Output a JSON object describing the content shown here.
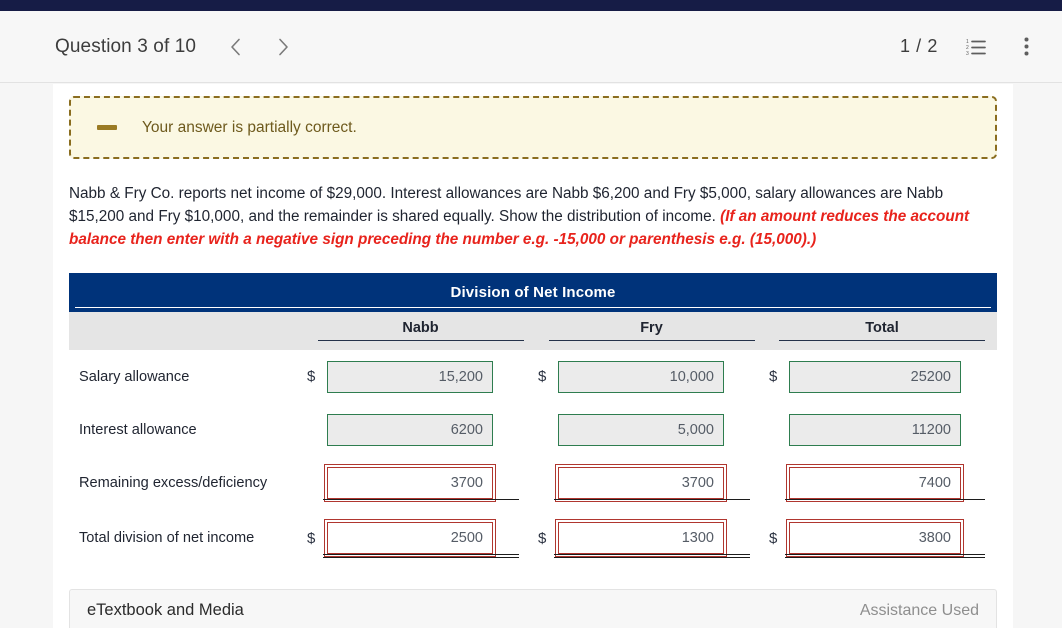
{
  "header": {
    "question_title": "Question 3 of 10",
    "prev_icon": "chevron-left-icon",
    "next_icon": "chevron-right-icon",
    "page_count": "1 / 2",
    "list_icon": "numbered-list-icon",
    "menu_icon": "more-vertical-icon"
  },
  "alert": {
    "icon": "minus-icon",
    "message": "Your answer is partially correct."
  },
  "question": {
    "body": "Nabb & Fry Co. reports net income of $29,000. Interest allowances are Nabb $6,200 and Fry $5,000, salary allowances are Nabb $15,200 and Fry $10,000, and the remainder is shared equally. Show the distribution of income. ",
    "warning": "(If an amount reduces the account balance then enter with a negative sign preceding the number e.g. -15,000 or parenthesis e.g. (15,000).)"
  },
  "table": {
    "title": "Division of Net Income",
    "columns": [
      "",
      "Nabb",
      "Fry",
      "Total"
    ],
    "rows": [
      {
        "label": "Salary allowance",
        "show_dollar": true,
        "underline": "none",
        "cells": [
          {
            "value": "15,200",
            "state": "correct"
          },
          {
            "value": "10,000",
            "state": "correct"
          },
          {
            "value": "25200",
            "state": "correct"
          }
        ]
      },
      {
        "label": "Interest allowance",
        "show_dollar": false,
        "underline": "none",
        "cells": [
          {
            "value": "6200",
            "state": "correct"
          },
          {
            "value": "5,000",
            "state": "correct"
          },
          {
            "value": "11200",
            "state": "correct"
          }
        ]
      },
      {
        "label": "Remaining excess/deficiency",
        "show_dollar": false,
        "underline": "single",
        "cells": [
          {
            "value": "3700",
            "state": "incorrect"
          },
          {
            "value": "3700",
            "state": "incorrect"
          },
          {
            "value": "7400",
            "state": "incorrect"
          }
        ]
      },
      {
        "label": "Total division of net income",
        "show_dollar": true,
        "underline": "double",
        "cells": [
          {
            "value": "2500",
            "state": "incorrect"
          },
          {
            "value": "1300",
            "state": "incorrect"
          },
          {
            "value": "3800",
            "state": "incorrect"
          }
        ]
      }
    ]
  },
  "footer": {
    "etextbook_label": "eTextbook and Media",
    "assistance_label": "Assistance Used"
  },
  "colors": {
    "navy_strip": "#161c46",
    "table_header": "#00337a",
    "correct_border": "#2e7d4f",
    "incorrect_border": "#b0362f",
    "warning_text": "#e8231c",
    "alert_bg": "#fbf8e3",
    "alert_border": "#8a6d1f"
  }
}
